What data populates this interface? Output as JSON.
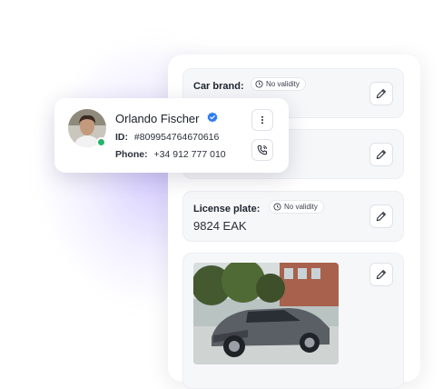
{
  "contact": {
    "name": "Orlando Fischer",
    "id_label": "ID:",
    "id_value": "#809954764670616",
    "phone_label": "Phone:",
    "phone_value": "+34 912 777 010",
    "status": "online"
  },
  "fields": [
    {
      "label": "Car brand:",
      "validity": "No validity",
      "value": ""
    },
    {
      "label": "",
      "validity": "",
      "value": ""
    },
    {
      "label": "License plate:",
      "validity": "No validity",
      "value": "9824 EAK"
    },
    {
      "label": "",
      "validity": "",
      "value": ""
    }
  ],
  "colors": {
    "accent": "#2e7cf6",
    "online": "#26b36b",
    "glow": "#a18cff"
  },
  "icons": {
    "edit": "pencil-icon",
    "more": "more-vertical-icon",
    "call": "phone-call-icon",
    "validity": "clock-icon",
    "verified": "verified-badge-icon"
  }
}
